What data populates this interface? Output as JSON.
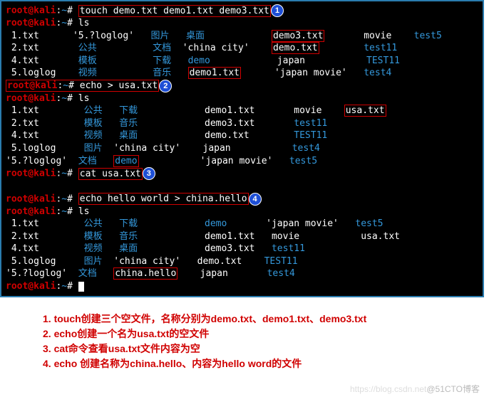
{
  "prompt": {
    "user": "root@kali",
    "path": "~",
    "sep": ":",
    "hash": "#"
  },
  "cmds": {
    "touch": "touch demo.txt demo1.txt demo3.txt",
    "ls1": "ls",
    "echo_usa": "echo > usa.txt",
    "ls2": "ls",
    "cat": "cat usa.txt",
    "echo_hello": "echo hello world > china.hello",
    "ls3": "ls"
  },
  "circles": {
    "c1": "1",
    "c2": "2",
    "c3": "3",
    "c4": "4"
  },
  "ls1": {
    "r1c1": " 1.txt",
    "r1c2": "'5.?loglog'",
    "r1c3": "图片",
    "r1c4": "桌面",
    "r1c5": "demo3.txt",
    "r1c6": "movie",
    "r1c7": "test5",
    "r2c1": " 2.txt",
    "r2c2": "公共",
    "r2c3": "文档",
    "r2c4": "'china city'",
    "r2c5": "demo.txt",
    "r2c6": "test11",
    "r3c1": " 4.txt",
    "r3c2": "模板",
    "r3c3": "下载",
    "r3c4": "demo",
    "r3c5": "japan",
    "r3c6": "TEST11",
    "r4c1": " 5.loglog",
    "r4c2": "视频",
    "r4c3": "音乐",
    "r4c4": "demo1.txt",
    "r4c5": "'japan movie'",
    "r4c6": "test4"
  },
  "ls2": {
    "r1c1": " 1.txt",
    "r1c2": "公共",
    "r1c3": "下载",
    "r1c4": "demo1.txt",
    "r1c5": "movie",
    "r1c6": "usa.txt",
    "r2c1": " 2.txt",
    "r2c2": "模板",
    "r2c3": "音乐",
    "r2c4": "demo3.txt",
    "r2c5": "test11",
    "r3c1": " 4.txt",
    "r3c2": "视频",
    "r3c3": "桌面",
    "r3c4": "demo.txt",
    "r3c5": "TEST11",
    "r4c1": " 5.loglog",
    "r4c2": "图片",
    "r4c3": "'china city'",
    "r4c4": "japan",
    "r4c5": "test4",
    "r5c1": "'5.?loglog'",
    "r5c2": "文档",
    "r5c3": "demo",
    "r5c4": "'japan movie'",
    "r5c5": "test5"
  },
  "ls3": {
    "r1c1": " 1.txt",
    "r1c2": "公共",
    "r1c3": "下载",
    "r1c4": "demo",
    "r1c5": "'japan movie'",
    "r1c6": "test5",
    "r2c1": " 2.txt",
    "r2c2": "模板",
    "r2c3": "音乐",
    "r2c4": "demo1.txt",
    "r2c5": "movie",
    "r2c6": "usa.txt",
    "r3c1": " 4.txt",
    "r3c2": "视频",
    "r3c3": "桌面",
    "r3c4": "demo3.txt",
    "r3c5": "test11",
    "r4c1": " 5.loglog",
    "r4c2": "图片",
    "r4c3": "'china city'",
    "r4c4": "demo.txt",
    "r4c5": "TEST11",
    "r5c1": "'5.?loglog'",
    "r5c2": "文档",
    "r5c3": "china.hello",
    "r5c4": "japan",
    "r5c5": "test4"
  },
  "annot": {
    "l1": "1. touch创建三个空文件，名称分别为demo.txt、demo1.txt、demo3.txt",
    "l2": "2. echo创建一个名为usa.txt的空文件",
    "l3": "3. cat命令查看usa.txt文件内容为空",
    "l4": "4. echo 创建名称为china.hello、内容为hello word的文件"
  },
  "watermark": {
    "left": "https://blog.csdn.net",
    "right": "@51CTO博客"
  }
}
